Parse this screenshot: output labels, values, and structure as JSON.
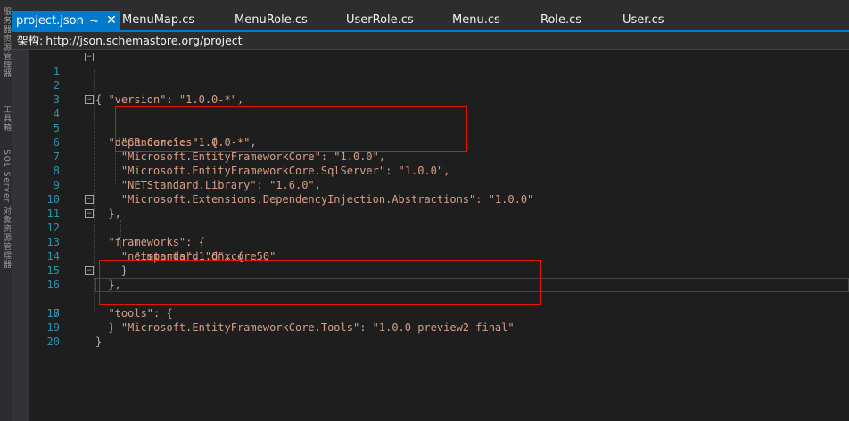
{
  "left_strip": {
    "labels": [
      "服务器资源管理器",
      "工具箱",
      "SQL Server 对象资源管理器"
    ]
  },
  "tabs": [
    {
      "label": "project.json",
      "active": true,
      "pin_icon": "pin-icon",
      "close_icon": "close-icon"
    },
    {
      "label": "MenuMap.cs"
    },
    {
      "label": "MenuRole.cs"
    },
    {
      "label": "UserRole.cs"
    },
    {
      "label": "Menu.cs"
    },
    {
      "label": "Role.cs"
    },
    {
      "label": "User.cs"
    }
  ],
  "schema": {
    "label": "架构:",
    "url": "http://json.schemastore.org/project"
  },
  "editor": {
    "lines": [
      {
        "n": "1",
        "text": "{"
      },
      {
        "n": "2",
        "text": "  \"version\": \"1.0.0-*\","
      },
      {
        "n": "3",
        "text": ""
      },
      {
        "n": "4",
        "text": "  \"dependencies\": {"
      },
      {
        "n": "5",
        "text": "    \"GR.Core\": \"1.0.0-*\","
      },
      {
        "n": "6",
        "text": "    \"Microsoft.EntityFrameworkCore\": \"1.0.0\","
      },
      {
        "n": "7",
        "text": "    \"Microsoft.EntityFrameworkCore.SqlServer\": \"1.0.0\","
      },
      {
        "n": "8",
        "text": "    \"NETStandard.Library\": \"1.6.0\","
      },
      {
        "n": "9",
        "text": "    \"Microsoft.Extensions.DependencyInjection.Abstractions\": \"1.0.0\""
      },
      {
        "n": "10",
        "text": "  },"
      },
      {
        "n": "11",
        "text": "  \"frameworks\": {"
      },
      {
        "n": "12",
        "text": "    \"netstandard1.6\": {"
      },
      {
        "n": "13",
        "text": "      \"imports\": \"dnxcore50\""
      },
      {
        "n": "14",
        "text": "    }"
      },
      {
        "n": "15",
        "text": "  },"
      },
      {
        "n": "16",
        "text": "  \"tools\": {"
      },
      {
        "n": "17",
        "text": "    \"Microsoft.EntityFrameworkCore.Tools\": \"1.0.0-preview2-final\""
      },
      {
        "n": "18",
        "text": "  }"
      },
      {
        "n": "19",
        "text": "}"
      },
      {
        "n": "20",
        "text": ""
      }
    ]
  },
  "colors": {
    "accent": "#007acc",
    "line_number": "#2b91af",
    "string": "#d69d85",
    "highlight_box": "#e51400"
  }
}
